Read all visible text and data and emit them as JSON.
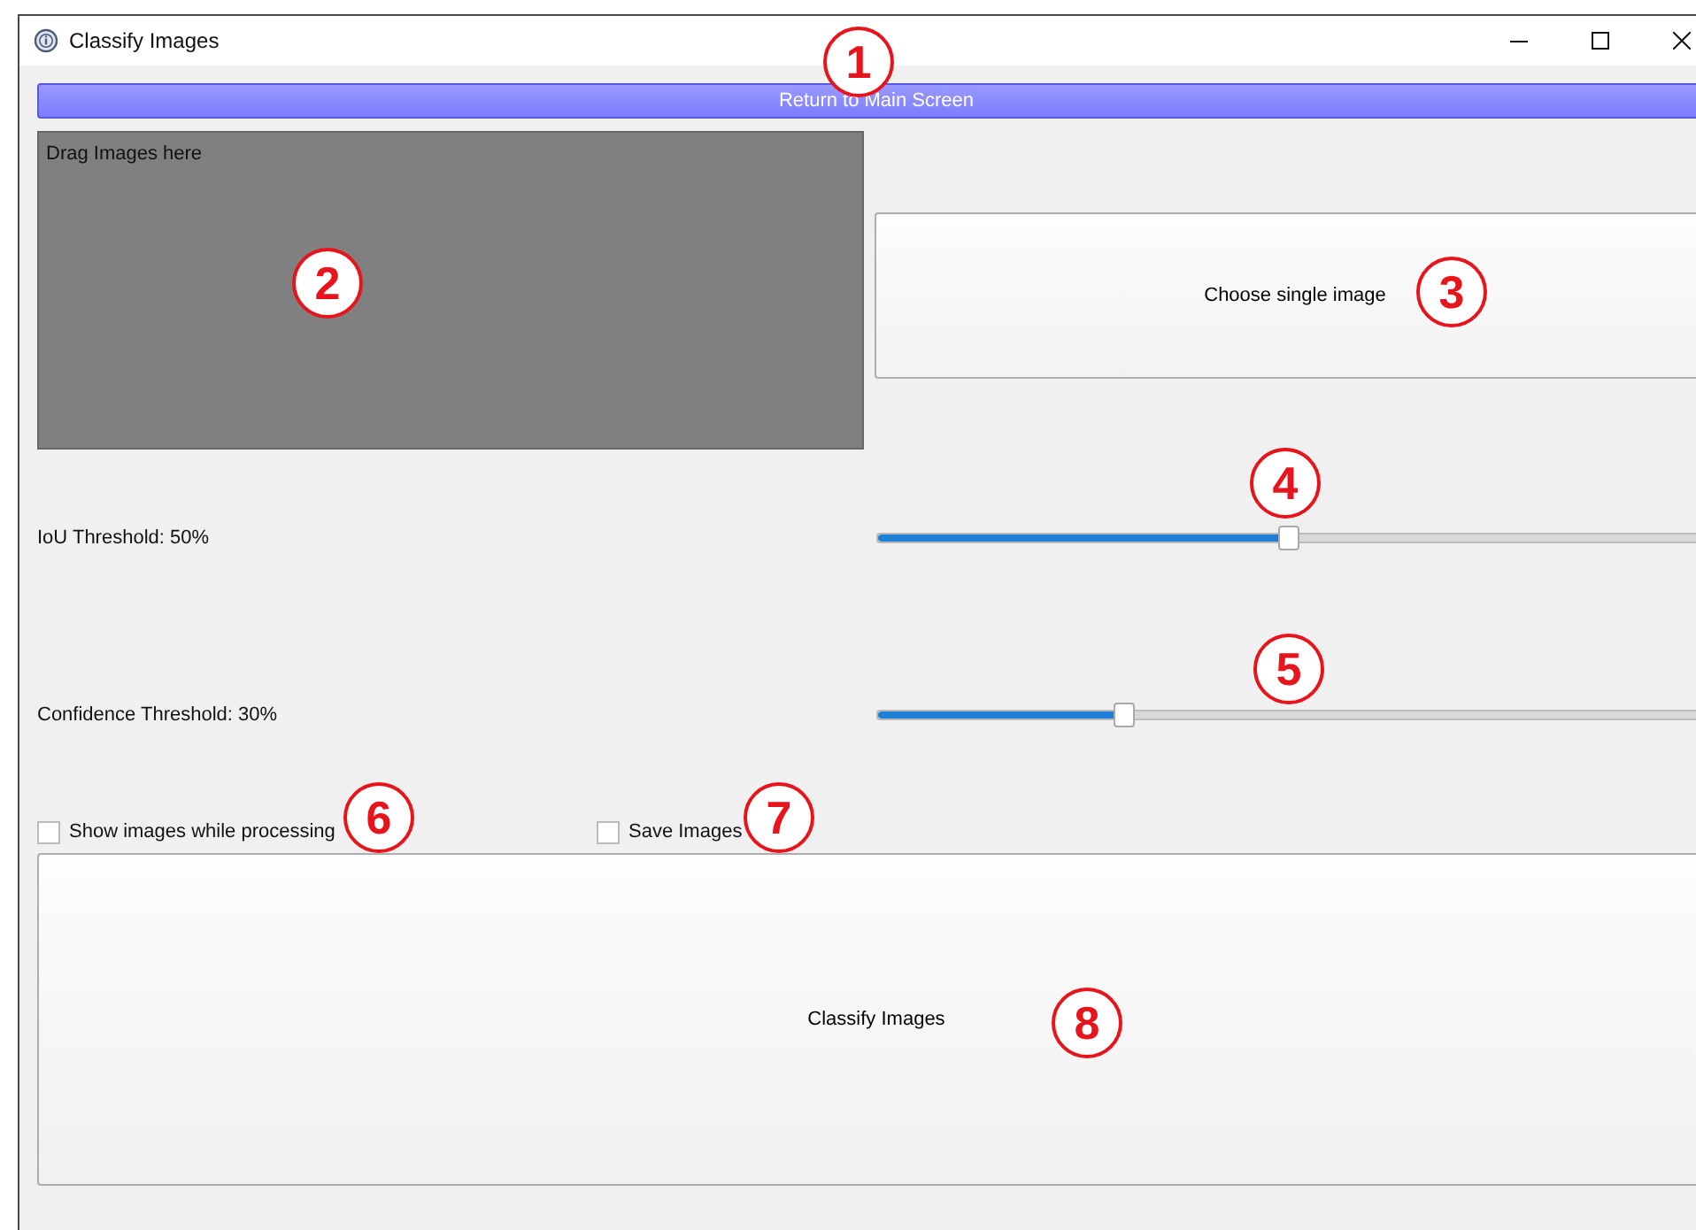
{
  "window": {
    "title": "Classify Images"
  },
  "return_button": {
    "label": "Return to Main Screen"
  },
  "drop_area": {
    "label": "Drag Images here"
  },
  "choose_button": {
    "label": "Choose single image"
  },
  "sliders": [
    {
      "label": "IoU Threshold: 50%",
      "level": 0.5
    },
    {
      "label": "Confidence Threshold: 30%",
      "level": 0.3
    }
  ],
  "checkboxes": [
    {
      "label": "Show images while processing",
      "checked": false
    },
    {
      "label": "Save Images",
      "checked": false
    }
  ],
  "classify_button": {
    "label": "Classify Images"
  },
  "annotations": [
    {
      "label": "1"
    },
    {
      "label": "2"
    },
    {
      "label": "3"
    },
    {
      "label": "4"
    },
    {
      "label": "5"
    },
    {
      "label": "6"
    },
    {
      "label": "7"
    },
    {
      "label": "8"
    }
  ]
}
